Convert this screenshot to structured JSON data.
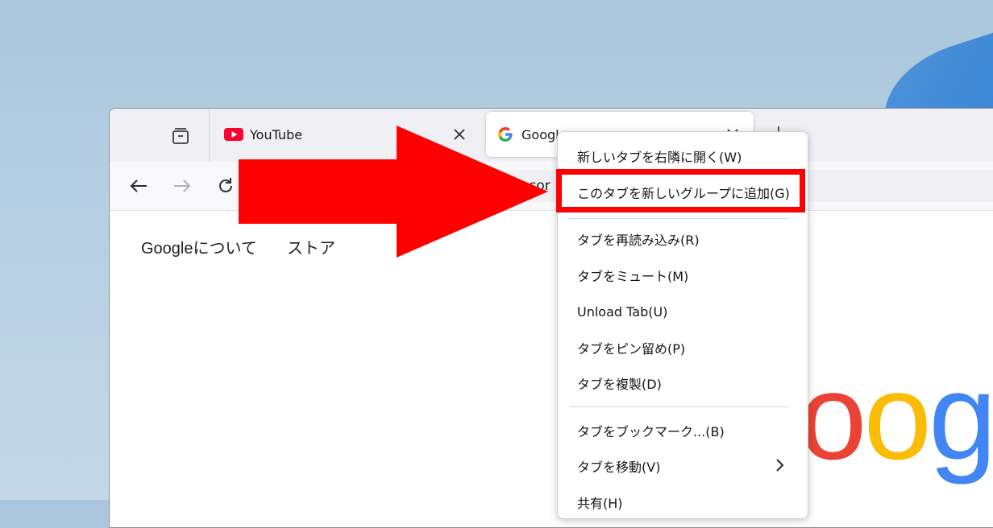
{
  "tabs": [
    {
      "title": "YouTube"
    },
    {
      "title": "Googl"
    }
  ],
  "address": {
    "partial_text": "cor"
  },
  "page_links": [
    "Googleについて",
    "ストア"
  ],
  "logo_text": "oogl",
  "context_menu": {
    "items": [
      {
        "label": "新しいタブを右隣に開く(W)"
      },
      {
        "label": "このタブを新しいグループに追加(G)"
      },
      {
        "label": "タブを再読み込み(R)"
      },
      {
        "label": "タブをミュート(M)"
      },
      {
        "label": "Unload Tab(U)"
      },
      {
        "label": "タブをピン留め(P)"
      },
      {
        "label": "タブを複製(D)"
      },
      {
        "label": "タブをブックマーク...(B)"
      },
      {
        "label": "タブを移動(V)"
      },
      {
        "label": "共有(H)"
      }
    ]
  },
  "colors": {
    "annotation_red": "#ff0000",
    "google_blue": "#4285f4",
    "google_red": "#ea4335",
    "google_yellow": "#fbbc05",
    "google_green": "#34a853",
    "youtube_red": "#ff0033"
  }
}
